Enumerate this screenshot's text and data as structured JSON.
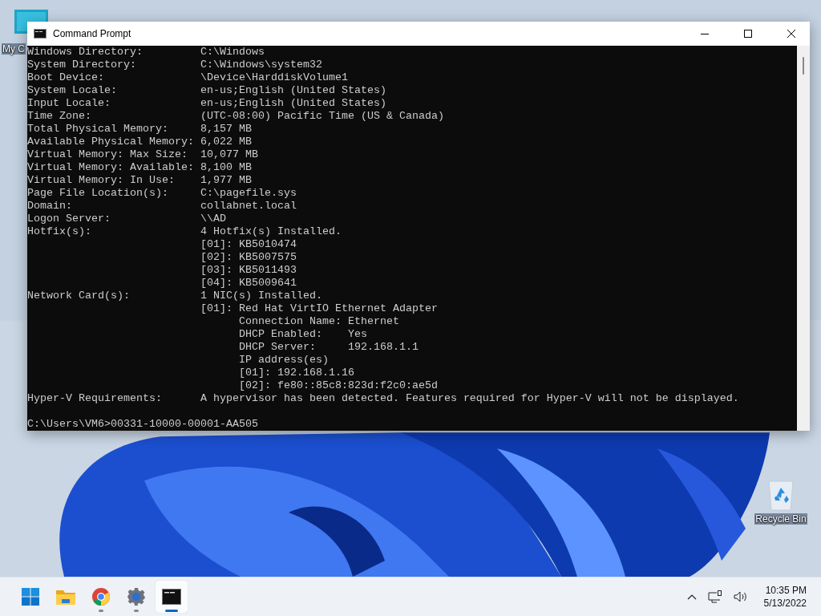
{
  "desktop": {
    "icons": [
      {
        "label": "My C",
        "kind": "computer"
      },
      {
        "label": "Recycle Bin",
        "kind": "recycle"
      }
    ]
  },
  "window": {
    "title": "Command Prompt",
    "console": {
      "lines": [
        "Windows Directory:         C:\\Windows",
        "System Directory:          C:\\Windows\\system32",
        "Boot Device:               \\Device\\HarddiskVolume1",
        "System Locale:             en-us;English (United States)",
        "Input Locale:              en-us;English (United States)",
        "Time Zone:                 (UTC-08:00) Pacific Time (US & Canada)",
        "Total Physical Memory:     8,157 MB",
        "Available Physical Memory: 6,022 MB",
        "Virtual Memory: Max Size:  10,077 MB",
        "Virtual Memory: Available: 8,100 MB",
        "Virtual Memory: In Use:    1,977 MB",
        "Page File Location(s):     C:\\pagefile.sys",
        "Domain:                    collabnet.local",
        "Logon Server:              \\\\AD",
        "Hotfix(s):                 4 Hotfix(s) Installed.",
        "                           [01]: KB5010474",
        "                           [02]: KB5007575",
        "                           [03]: KB5011493",
        "                           [04]: KB5009641",
        "Network Card(s):           1 NIC(s) Installed.",
        "                           [01]: Red Hat VirtIO Ethernet Adapter",
        "                                 Connection Name: Ethernet",
        "                                 DHCP Enabled:    Yes",
        "                                 DHCP Server:     192.168.1.1",
        "                                 IP address(es)",
        "                                 [01]: 192.168.1.16",
        "                                 [02]: fe80::85c8:823d:f2c0:ae5d",
        "Hyper-V Requirements:      A hypervisor has been detected. Features required for Hyper-V will not be displayed.",
        "C:\\Users\\VM6>00331-10000-00001-AA505"
      ]
    }
  },
  "taskbar": {
    "apps": [
      {
        "kind": "start",
        "running": false,
        "selected": false
      },
      {
        "kind": "folder",
        "running": false,
        "selected": false
      },
      {
        "kind": "browser",
        "running": true,
        "selected": false
      },
      {
        "kind": "settings",
        "running": true,
        "selected": false
      },
      {
        "kind": "terminal",
        "running": true,
        "selected": true
      }
    ],
    "clock": {
      "time": "10:35 PM",
      "date": "5/13/2022"
    }
  }
}
